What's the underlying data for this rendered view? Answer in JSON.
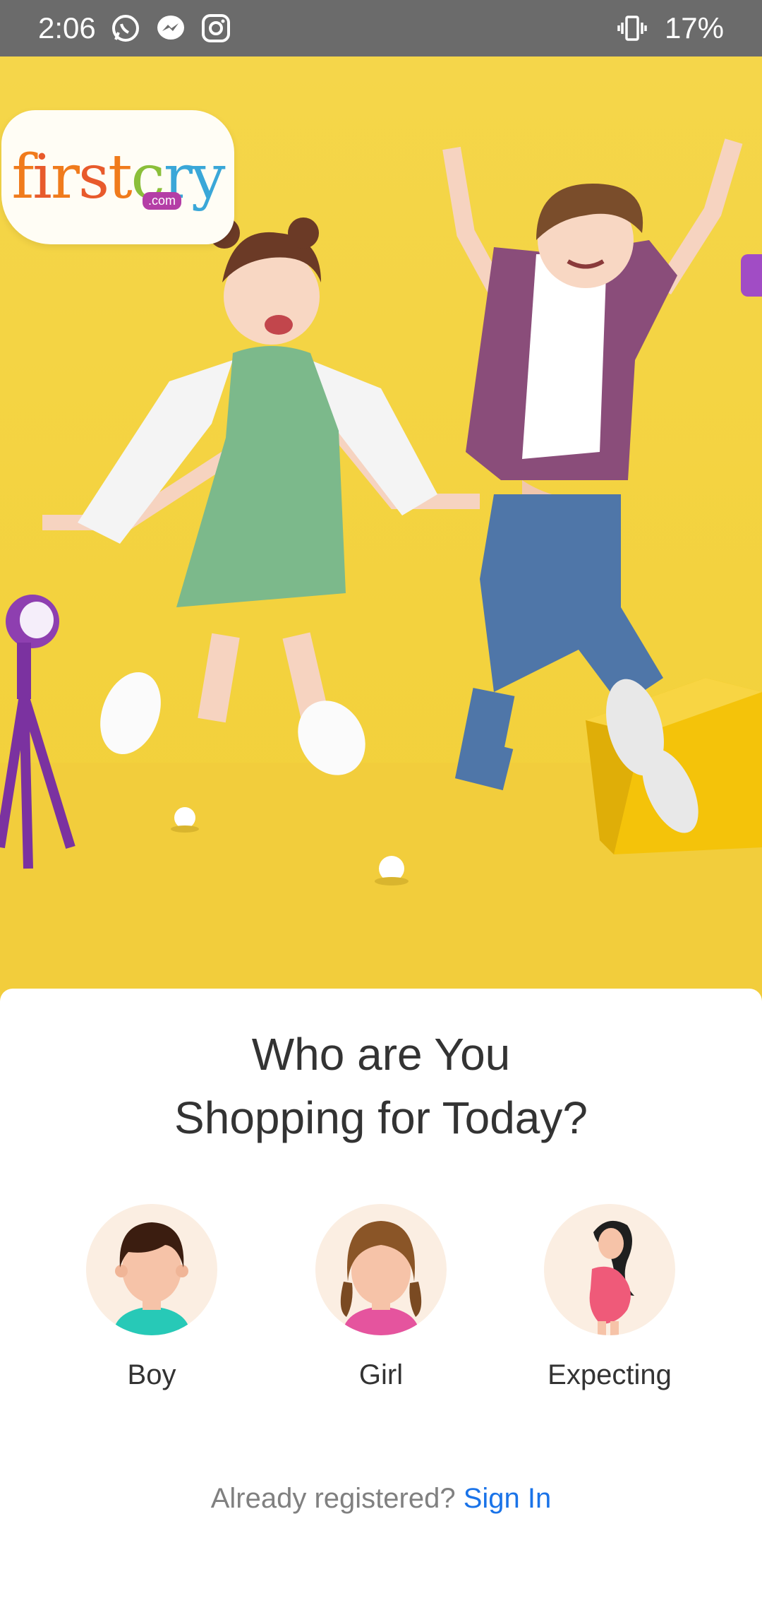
{
  "status_bar": {
    "time": "2:06",
    "battery": "17%",
    "notification_icons": [
      "whatsapp-icon",
      "messenger-icon",
      "instagram-icon"
    ],
    "right_icons": [
      "vibrate-icon"
    ]
  },
  "hero": {
    "logo_text": "firstcry",
    "logo_sub": ".com",
    "background_color": "#f3d23e"
  },
  "card": {
    "title_line1": "Who are You",
    "title_line2": "Shopping for Today?",
    "options": [
      {
        "label": "Boy",
        "icon": "boy-avatar-icon"
      },
      {
        "label": "Girl",
        "icon": "girl-avatar-icon"
      },
      {
        "label": "Expecting",
        "icon": "expecting-mother-icon"
      }
    ],
    "signin_prompt": "Already registered?",
    "signin_link": "Sign In"
  },
  "colors": {
    "link": "#1a73e8",
    "title": "#333333",
    "avatar_bg": "#fbeee2"
  }
}
